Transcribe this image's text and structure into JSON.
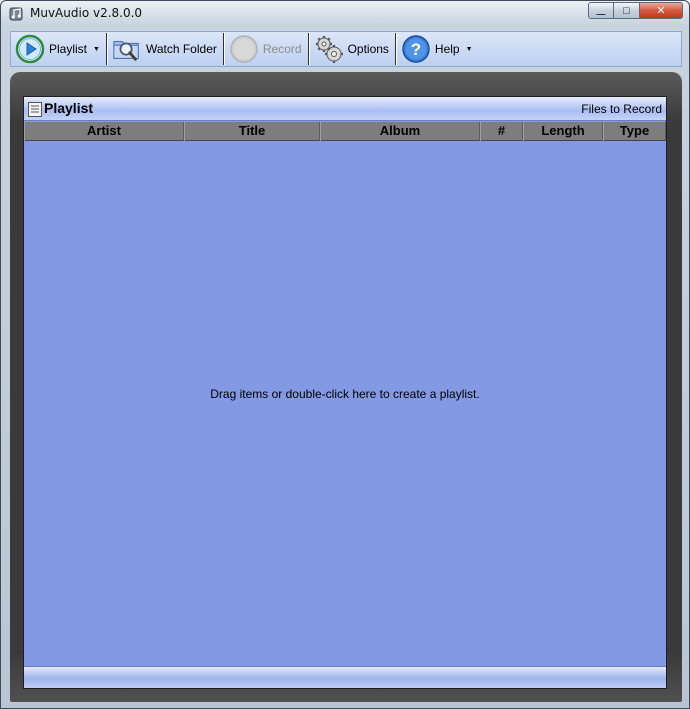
{
  "window": {
    "title": "MuvAudio v2.8.0.0",
    "minimize_glyph": "—",
    "maximize_glyph": "□",
    "close_glyph": "✕"
  },
  "toolbar": {
    "playlist_label": "Playlist",
    "watch_folder_label": "Watch Folder",
    "record_label": "Record",
    "options_label": "Options",
    "help_label": "Help",
    "dropdown_glyph": "▼"
  },
  "panel": {
    "title": "Playlist",
    "files_to_record": "Files to Record",
    "columns": [
      "Artist",
      "Title",
      "Album",
      "#",
      "Length",
      "Type"
    ],
    "empty_hint": "Drag items or double-click here to create a playlist."
  },
  "colors": {
    "list_background": "#8499e4",
    "toolbar_gradient_top": "#dbe6f8",
    "header_gray": "#7d7d7d"
  },
  "icons": {
    "playlist": "play-circle-icon",
    "watch_folder": "folder-magnifier-icon",
    "record": "record-disc-icon",
    "options": "gears-icon",
    "help": "help-question-icon"
  }
}
